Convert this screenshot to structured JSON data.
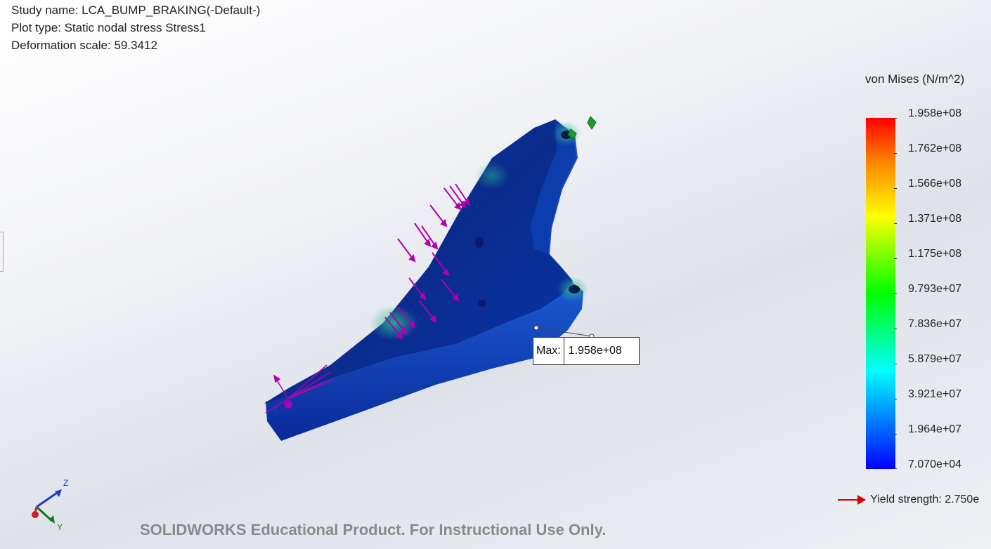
{
  "header": {
    "study_name": "Study name: LCA_BUMP_BRAKING(-Default-)",
    "plot_type": "Plot type: Static nodal stress Stress1",
    "deformation_scale": "Deformation scale: 59.3412"
  },
  "legend": {
    "title": "von Mises (N/m^2)",
    "ticks": [
      "1.958e+08",
      "1.762e+08",
      "1.566e+08",
      "1.371e+08",
      "1.175e+08",
      "9.793e+07",
      "7.836e+07",
      "5.879e+07",
      "3.921e+07",
      "1.964e+07",
      "7.070e+04"
    ],
    "colors": [
      "#ff0000",
      "#ff8000",
      "#ffff00",
      "#00ff00",
      "#00ffff",
      "#0080ff",
      "#0000ff"
    ]
  },
  "probe": {
    "label": "Max:",
    "value": "1.958e+08"
  },
  "yield": {
    "label": "Yield strength: 2.750e"
  },
  "triad": {
    "z": "Z",
    "y": "Y"
  },
  "watermark": "SOLIDWORKS Educational Product. For Instructional Use Only.",
  "colors": {
    "part_body": "#0a2a8a",
    "load_arrows": "#b000b0",
    "fixture": "#1a9a2a"
  }
}
